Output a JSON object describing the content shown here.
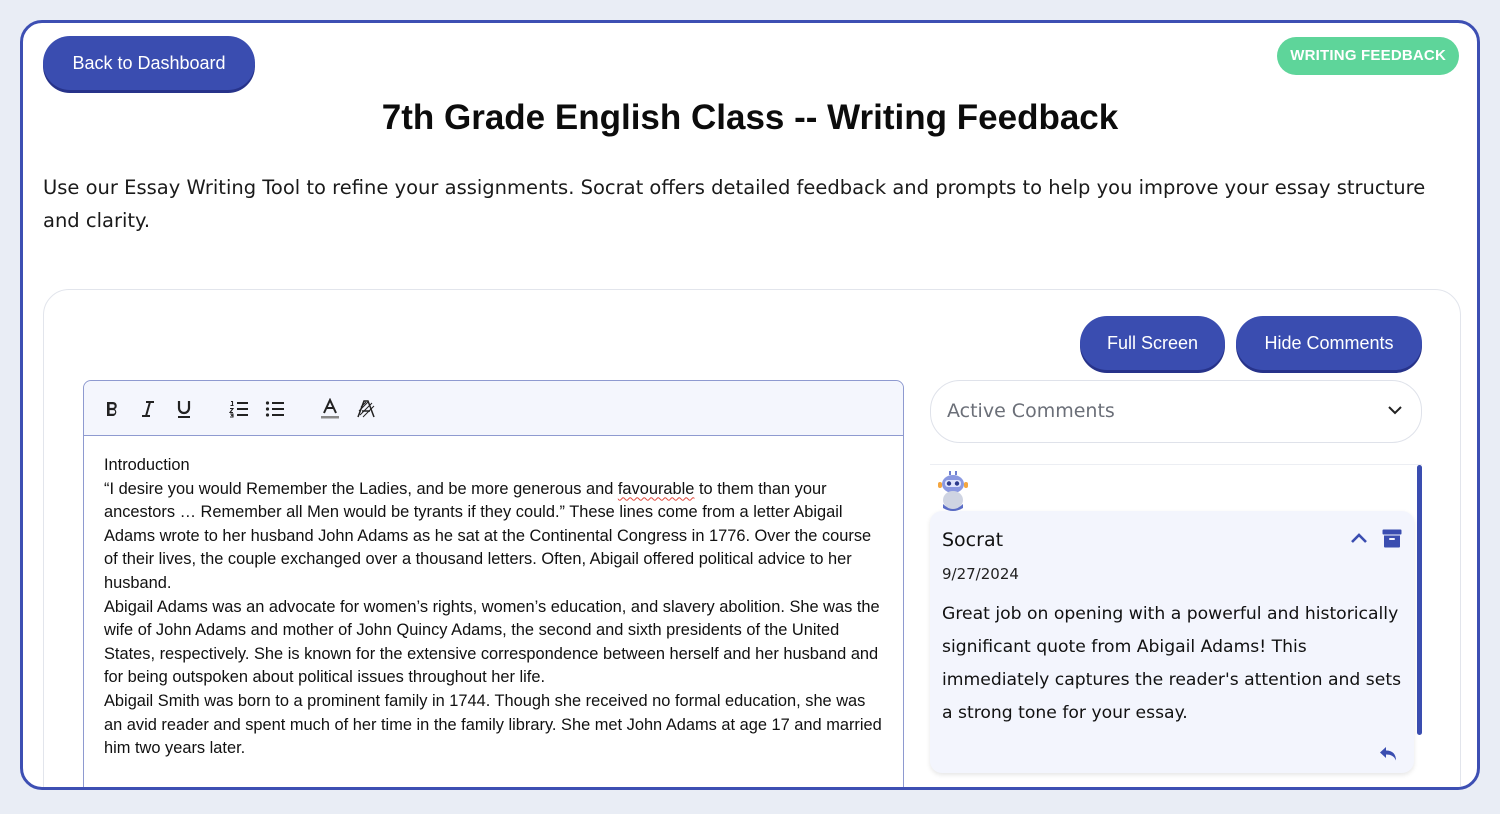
{
  "header": {
    "back_label": "Back to Dashboard",
    "badge": "WRITING FEEDBACK",
    "title": "7th Grade English Class -- Writing Feedback",
    "intro": "Use our Essay Writing Tool to refine your assignments. Socrat offers detailed feedback and prompts to help you improve your essay structure and clarity."
  },
  "actions": {
    "full_screen": "Full Screen",
    "hide_comments": "Hide Comments"
  },
  "toolbar": {
    "icons": [
      "bold-icon",
      "italic-icon",
      "underline-icon",
      "ordered-list-icon",
      "bullet-list-icon",
      "text-color-icon",
      "highlight-icon"
    ]
  },
  "essay": {
    "heading": "Introduction",
    "p1_before": "“I desire you would Remember the Ladies, and be more generous and ",
    "p1_flagged": "favourable",
    "p1_after": " to them than your ancestors … Remember all Men would be tyrants if they could.” These lines come from a letter Abigail Adams wrote to her husband John Adams as he sat at the Continental Congress in 1776. Over the course of their lives, the couple exchanged over a thousand letters. Often, Abigail offered political advice to her husband.",
    "p2": "Abigail Adams was an advocate for women’s rights, women’s education, and slavery abolition. She was the wife of John Adams and mother of John Quincy Adams, the second and sixth presidents of the United States, respectively. She is known for the extensive correspondence between herself and her husband and for being outspoken about political issues throughout her life.",
    "p3": "Abigail Smith was born to a prominent family in 1744. Though she received no formal education, she was an avid reader and spent much of her time in the family library. She met John Adams at age 17 and married him two years later."
  },
  "comments": {
    "filter_label": "Active Comments",
    "items": [
      {
        "author": "Socrat",
        "date": "9/27/2024",
        "text": "Great job on opening with a powerful and historically significant quote from Abigail Adams! This immediately captures the reader's attention and sets a strong tone for your essay."
      }
    ]
  },
  "colors": {
    "primary": "#3a4db0",
    "badge": "#5ed59a",
    "comment_bg": "#f3f5fd",
    "spell_error": "#e0453a"
  }
}
